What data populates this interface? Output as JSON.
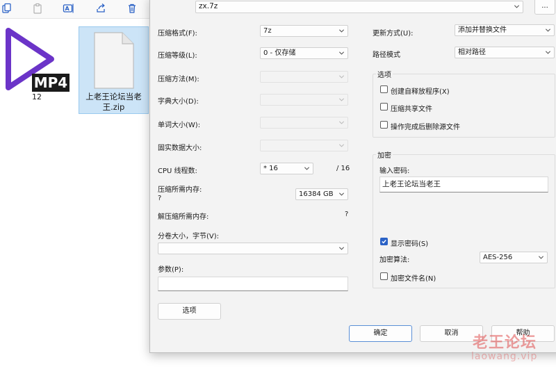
{
  "explorer": {
    "toolbar_icons": [
      "copy-icon",
      "paste-icon",
      "rename-icon",
      "share-icon",
      "delete-icon"
    ],
    "files": [
      {
        "badge": "MP4",
        "label": "12"
      },
      {
        "label": "上老王论坛当老王.zip"
      }
    ]
  },
  "dialog": {
    "archive_path": "zx.7z",
    "browse_label": "...",
    "left": {
      "format_label": "压缩格式(F):",
      "format_value": "7z",
      "level_label": "压缩等级(L):",
      "level_value": "0 - 仅存储",
      "method_label": "压缩方法(M):",
      "dict_label": "字典大小(D):",
      "word_label": "单词大小(W):",
      "solid_label": "固实数据大小:",
      "threads_label": "CPU 线程数:",
      "threads_value": "* 16",
      "threads_total": "/ 16",
      "mem_comp_label": "压缩所需内存:",
      "mem_comp_q": "?",
      "mem_comp_value": "16384 GB",
      "mem_decomp_label": "解压缩所需内存:",
      "mem_decomp_q": "?",
      "split_label": "分卷大小，字节(V):",
      "params_label": "参数(P):",
      "options_button": "选项"
    },
    "right": {
      "update_label": "更新方式(U):",
      "update_value": "添加并替换文件",
      "path_label": "路径模式",
      "path_value": "相对路径",
      "options_group": "选项",
      "opt_sfx": "创建自释放程序(X)",
      "opt_shared": "压缩共享文件",
      "opt_delete": "操作完成后删除源文件",
      "enc_group": "加密",
      "pwd_label": "输入密码:",
      "pwd_value": "上老王论坛当老王",
      "show_pwd": "显示密码(S)",
      "enc_method_label": "加密算法:",
      "enc_method_value": "AES-256",
      "enc_names": "加密文件名(N)"
    },
    "buttons": {
      "ok": "确定",
      "cancel": "取消",
      "help": "帮助"
    }
  },
  "watermark": {
    "cn": "老王论坛",
    "en": "laowang.vip"
  }
}
